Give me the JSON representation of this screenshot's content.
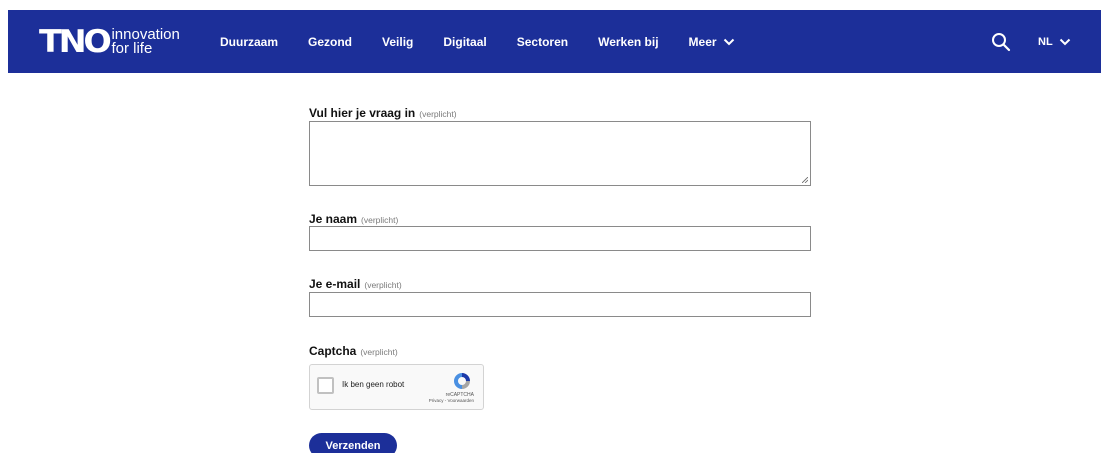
{
  "header": {
    "logo_mark": "TNO",
    "logo_tag_line1": "innovation",
    "logo_tag_line2": "for life",
    "nav": [
      {
        "label": "Duurzaam"
      },
      {
        "label": "Gezond"
      },
      {
        "label": "Veilig"
      },
      {
        "label": "Digitaal"
      },
      {
        "label": "Sectoren"
      },
      {
        "label": "Werken bij"
      },
      {
        "label": "Meer"
      }
    ],
    "language": "NL",
    "icons": {
      "search": "search-icon",
      "dropdown": "chevron-down-icon"
    },
    "background_color": "#1c2f99"
  },
  "form": {
    "question": {
      "label": "Vul hier je vraag in",
      "required": "(verplicht)",
      "value": ""
    },
    "name": {
      "label": "Je naam",
      "required": "(verplicht)",
      "value": ""
    },
    "email": {
      "label": "Je e-mail",
      "required": "(verplicht)",
      "value": ""
    },
    "captcha": {
      "label": "Captcha",
      "required": "(verplicht)",
      "checkbox_text": "Ik ben geen robot",
      "brand": "reCAPTCHA",
      "links": "Privacy - Voorwaarden"
    },
    "submit_label": "Verzenden"
  }
}
